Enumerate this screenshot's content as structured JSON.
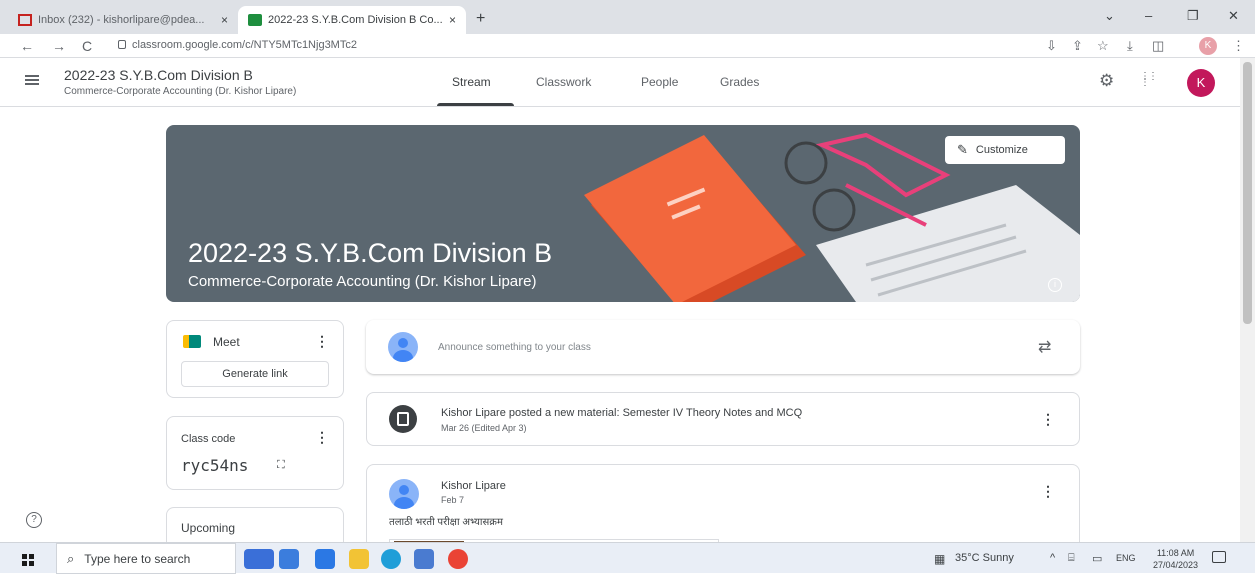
{
  "browser": {
    "tabs": [
      {
        "title": "Inbox (232) - kishorlipare@pdea...",
        "active": false
      },
      {
        "title": "2022-23 S.Y.B.Com Division B Co...",
        "active": true
      }
    ],
    "new_tab": "+",
    "close": "×",
    "url": "classroom.google.com/c/NTY5MTc1Njg3MTc2",
    "profile_letter": "K",
    "nav": {
      "back": "←",
      "forward": "→",
      "reload": "C"
    },
    "window_controls": {
      "chevron": "⌄",
      "minimize": "–",
      "restore": "❐",
      "close": "✕"
    },
    "toolbar_icons": {
      "install": "⇩",
      "share": "⇪",
      "bookmark": "☆",
      "download": "⤓",
      "sidepanel": "◫",
      "menu": "⋮"
    }
  },
  "header": {
    "class_title": "2022-23 S.Y.B.Com Division B",
    "class_subtitle": "Commerce-Corporate Accounting (Dr. Kishor Lipare)",
    "tabs": [
      "Stream",
      "Classwork",
      "People",
      "Grades"
    ],
    "active_tab": "Stream",
    "settings_icon": "⚙",
    "apps_icon": "⋮⋮⋮",
    "avatar_letter": "K"
  },
  "banner": {
    "title": "2022-23 S.Y.B.Com Division B",
    "subtitle": "Commerce-Corporate Accounting (Dr. Kishor Lipare)",
    "customize_label": "Customize",
    "pen_icon": "✎",
    "info_icon": "i",
    "colors": {
      "bg": "#5b6770",
      "book": "#f2673d",
      "glasses": "#e8407a"
    }
  },
  "meet": {
    "label": "Meet",
    "generate_link": "Generate link",
    "menu": "⋮"
  },
  "class_code": {
    "label": "Class code",
    "value": "ryc54ns",
    "expand_icon": "⛶",
    "menu": "⋮"
  },
  "upcoming": {
    "label": "Upcoming"
  },
  "help_icon": "?",
  "announce": {
    "placeholder": "Announce something to your class",
    "repost_icon": "⇄"
  },
  "posts": [
    {
      "title": "Kishor Lipare posted a new material: Semester IV Theory Notes and MCQ",
      "date": "Mar 26 (Edited Apr 3)",
      "menu": "⋮"
    },
    {
      "author": "Kishor Lipare",
      "date": "Feb 7",
      "text": "तलाठी भरती परीक्षा अभ्यासक्रम",
      "menu": "⋮"
    }
  ],
  "taskbar": {
    "search_placeholder": "Type here to search",
    "search_icon": "⌕",
    "weather": "35°C Sunny",
    "tray": {
      "chevron": "^",
      "network": "⌸",
      "battery": "▭",
      "lang": "ENG"
    },
    "time": "11:08 AM",
    "date": "27/04/2023"
  }
}
